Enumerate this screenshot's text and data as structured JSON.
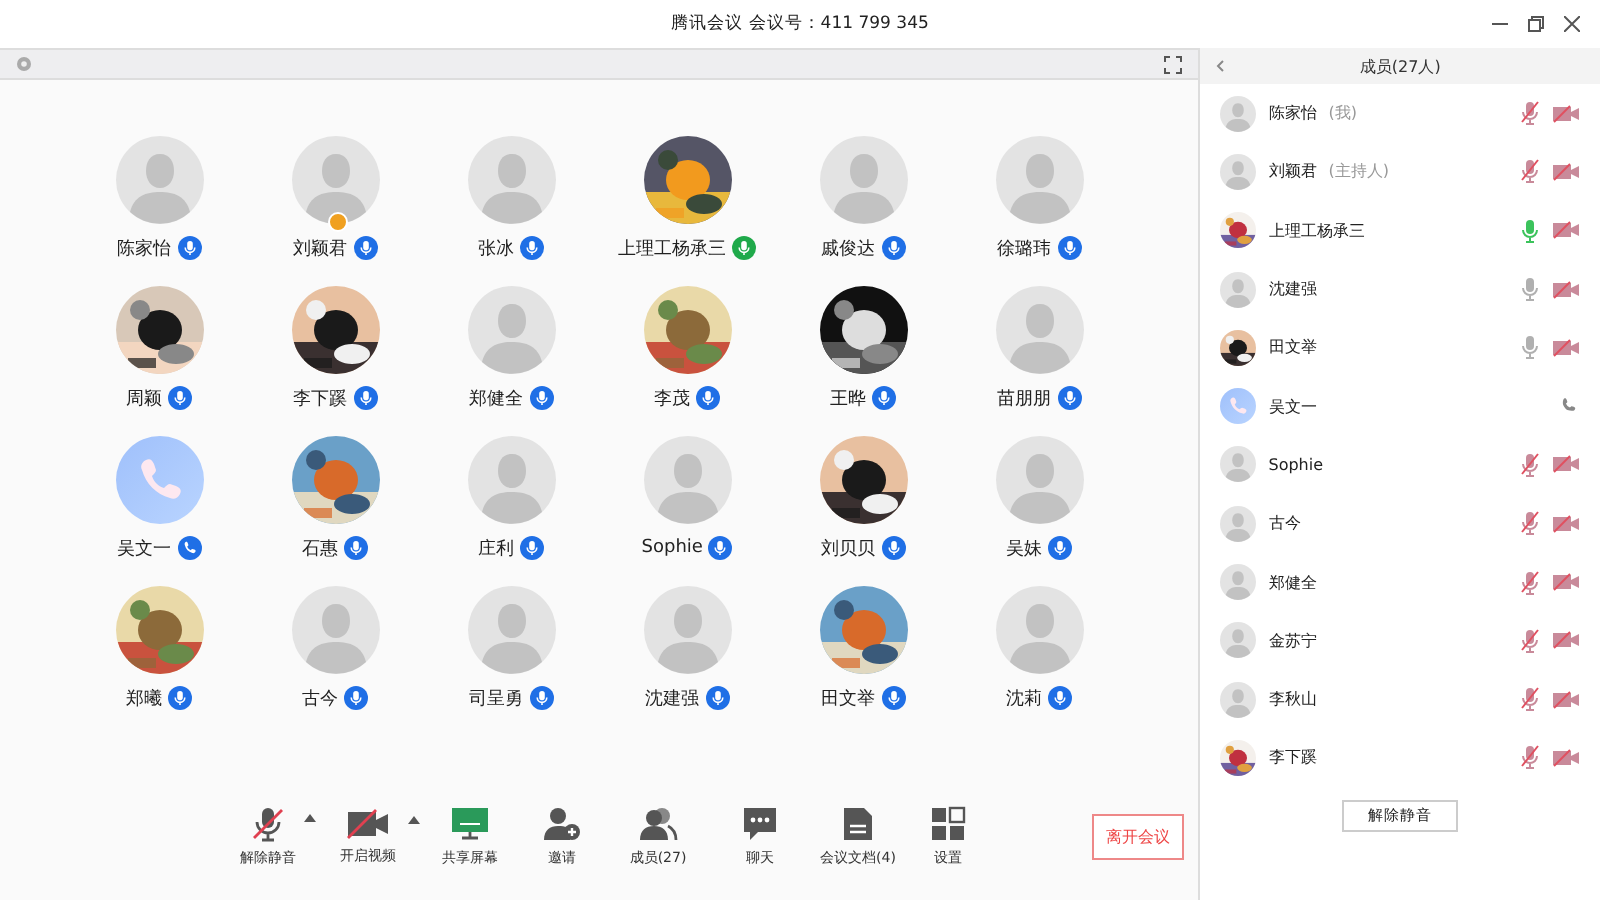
{
  "window": {
    "title": "腾讯会议 会议号：411 799 345"
  },
  "participants": [
    {
      "name": "陈家怡",
      "kind": "default",
      "speaking": false,
      "host": false
    },
    {
      "name": "刘颖君",
      "kind": "default",
      "speaking": false,
      "host": true
    },
    {
      "name": "张冰",
      "kind": "default",
      "speaking": false,
      "host": false
    },
    {
      "name": "上理工杨承三",
      "kind": "picture",
      "speaking": true,
      "host": false
    },
    {
      "name": "戚俊达",
      "kind": "default",
      "speaking": false,
      "host": false
    },
    {
      "name": "徐璐玮",
      "kind": "default",
      "speaking": false,
      "host": false
    },
    {
      "name": "周颖",
      "kind": "picture",
      "speaking": false,
      "host": false
    },
    {
      "name": "李下蹊",
      "kind": "picture",
      "speaking": false,
      "host": false
    },
    {
      "name": "郑健全",
      "kind": "default",
      "speaking": false,
      "host": false
    },
    {
      "name": "李茂",
      "kind": "picture",
      "speaking": false,
      "host": false
    },
    {
      "name": "王晔",
      "kind": "picture",
      "speaking": false,
      "host": false
    },
    {
      "name": "苗朋朋",
      "kind": "default",
      "speaking": false,
      "host": false
    },
    {
      "name": "吴文一",
      "kind": "phone",
      "host": false
    },
    {
      "name": "石惠",
      "kind": "picture",
      "speaking": false,
      "host": false
    },
    {
      "name": "庄利",
      "kind": "default",
      "speaking": false,
      "host": false
    },
    {
      "name": "Sophie",
      "kind": "default",
      "speaking": false,
      "host": false
    },
    {
      "name": "刘贝贝",
      "kind": "picture",
      "speaking": false,
      "host": false
    },
    {
      "name": "吴妹",
      "kind": "default",
      "speaking": false,
      "host": false
    },
    {
      "name": "郑曦",
      "kind": "picture",
      "speaking": false,
      "host": false
    },
    {
      "name": "古今",
      "kind": "default",
      "speaking": false,
      "host": false
    },
    {
      "name": "司呈勇",
      "kind": "default",
      "speaking": false,
      "host": false
    },
    {
      "name": "沈建强",
      "kind": "default",
      "speaking": false,
      "host": false
    },
    {
      "name": "田文举",
      "kind": "picture",
      "speaking": false,
      "host": false
    },
    {
      "name": "沈莉",
      "kind": "default",
      "speaking": false,
      "host": false
    }
  ],
  "toolbar": [
    {
      "label": "解除静音",
      "kind": "mic",
      "caret": true
    },
    {
      "label": "开启视频",
      "kind": "video",
      "caret": true
    },
    {
      "label": "共享屏幕",
      "kind": "share",
      "caret": false
    },
    {
      "label": "邀请",
      "kind": "invite",
      "caret": false
    },
    {
      "label": "成员(27)",
      "kind": "members",
      "caret": false
    },
    {
      "label": "聊天",
      "kind": "chat",
      "caret": false
    },
    {
      "label": "会议文档(4)",
      "kind": "docs",
      "caret": false
    },
    {
      "label": "设置",
      "kind": "settings",
      "caret": false
    }
  ],
  "leave_button": "离开会议",
  "members_panel": {
    "title": "成员(27人)",
    "members": [
      {
        "name": "陈家怡",
        "tag": "(我)",
        "kind": "default",
        "muted": true,
        "speaking": false,
        "video": false
      },
      {
        "name": "刘颖君",
        "tag": "(主持人)",
        "kind": "default",
        "muted": true,
        "speaking": false,
        "video": false
      },
      {
        "name": "上理工杨承三",
        "kind": "picture",
        "muted": false,
        "speaking": true,
        "video": false
      },
      {
        "name": "沈建强",
        "kind": "default",
        "muted": false,
        "speaking": false,
        "video": false
      },
      {
        "name": "田文举",
        "kind": "picture",
        "muted": false,
        "speaking": false,
        "video": false
      },
      {
        "name": "吴文一",
        "kind": "phone"
      },
      {
        "name": "Sophie",
        "kind": "default",
        "muted": true,
        "speaking": false,
        "video": false
      },
      {
        "name": "古今",
        "kind": "default",
        "muted": true,
        "speaking": false,
        "video": false
      },
      {
        "name": "郑健全",
        "kind": "default",
        "muted": true,
        "speaking": false,
        "video": false
      },
      {
        "name": "金苏宁",
        "kind": "default",
        "muted": true,
        "speaking": false,
        "video": false
      },
      {
        "name": "李秋山",
        "kind": "default",
        "muted": true,
        "speaking": false,
        "video": false
      },
      {
        "name": "李下蹊",
        "kind": "picture",
        "muted": true,
        "speaking": false,
        "video": false
      }
    ],
    "unmute_all_button": "解除静音"
  }
}
